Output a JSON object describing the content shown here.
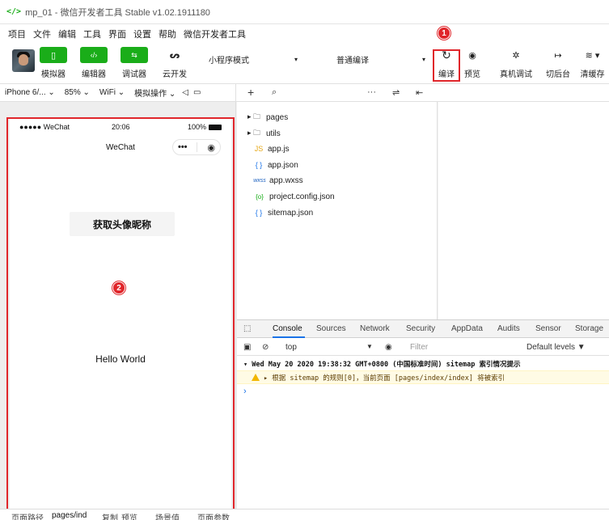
{
  "window": {
    "title": "mp_01 - 微信开发者工具 Stable v1.02.1911180",
    "logo": "</>"
  },
  "menu": [
    "项目",
    "文件",
    "编辑",
    "工具",
    "界面",
    "设置",
    "帮助",
    "微信开发者工具"
  ],
  "toolbar": {
    "simulator": "模拟器",
    "editor": "编辑器",
    "debugger": "调试器",
    "cloud": "云开发",
    "mode_select": "小程序模式",
    "compile_select": "普通编译",
    "compile": "编译",
    "preview": "预览",
    "real_debug": "真机调试",
    "background": "切后台",
    "clear_cache": "清缓存"
  },
  "subbar": {
    "device": "iPhone 6/... ⌄",
    "zoom": "85% ⌄",
    "network": "WiFi ⌄",
    "sim_ops": "模拟操作 ⌄"
  },
  "phone": {
    "carrier": "●●●●● WeChat",
    "time": "20:06",
    "battery": "100%",
    "nav_title": "WeChat",
    "button": "获取头像昵称",
    "hello": "Hello World"
  },
  "files": [
    {
      "name": "pages",
      "icon": "▸ 🗀"
    },
    {
      "name": "utils",
      "icon": "▸ 🗀"
    },
    {
      "name": "app.js",
      "icon": "JS"
    },
    {
      "name": "app.json",
      "icon": "{ }"
    },
    {
      "name": "app.wxss",
      "icon": "wxss"
    },
    {
      "name": "project.config.json",
      "icon": "{o}"
    },
    {
      "name": "sitemap.json",
      "icon": "{ }"
    }
  ],
  "devtools": {
    "tabs": [
      "Console",
      "Sources",
      "Network",
      "Security",
      "AppData",
      "Audits",
      "Sensor",
      "Storage"
    ],
    "context": "top",
    "filter_placeholder": "Filter",
    "levels": "Default levels ▼",
    "log_header": "▾ Wed May 20 2020 19:38:32 GMT+0800 (中国标准时间) sitemap 索引情况提示",
    "log_warning": "▸ 根据 sitemap 的规则[0]，当前页面 [pages/index/index] 将被索引",
    "prompt": "›"
  },
  "badges": {
    "one": "1",
    "two": "2"
  },
  "bottombar": {
    "path_label": "页面路径",
    "path_value": "pages/ind",
    "copy": "复制",
    "preview": "预览",
    "scene": "场景值",
    "params": "页面参数"
  },
  "colors": {
    "accent_green": "#1aad19",
    "highlight_red": "#e0262b",
    "link_blue": "#1a73e8",
    "warning_bg": "#fffbe5"
  }
}
